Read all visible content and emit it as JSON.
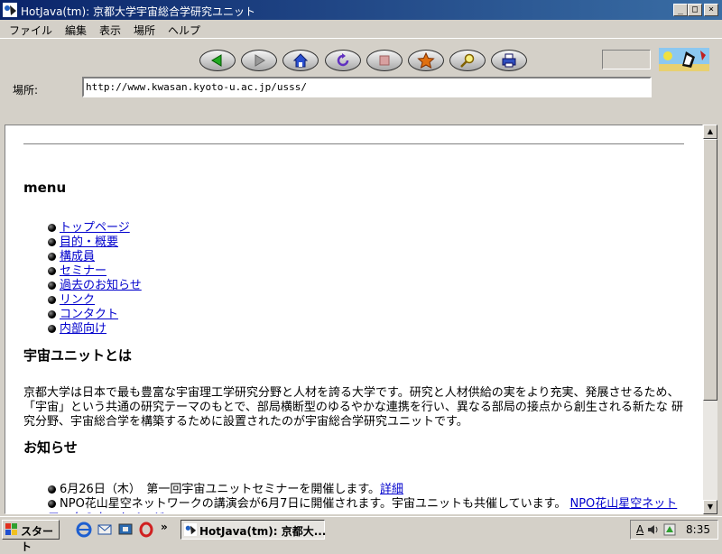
{
  "window": {
    "title": "HotJava(tm): 京都大学宇宙総合学研究ユニット",
    "minimize_glyph": "_",
    "maximize_glyph": "□",
    "close_glyph": "×"
  },
  "menu": [
    "ファイル",
    "編集",
    "表示",
    "場所",
    "ヘルプ"
  ],
  "toolbar": {
    "location_label": "場所:",
    "url": "http://www.kwasan.kyoto-u.ac.jp/usss/",
    "buttons": [
      "back-icon",
      "forward-icon",
      "home-icon",
      "reload-icon",
      "stop-icon",
      "bookmark-star-icon",
      "search-icon",
      "print-icon"
    ]
  },
  "page": {
    "menu_heading": "menu",
    "menu_links": [
      "トップページ",
      "目的・概要",
      "構成員",
      "セミナー",
      "過去のお知らせ",
      "リンク",
      "コンタクト",
      "内部向け"
    ],
    "about_heading": "宇宙ユニットとは",
    "about_text": "京都大学は日本で最も豊富な宇宙理工学研究分野と人材を誇る大学です。研究と人材供給の実をより充実、発展させるため、「宇宙」という共通の研究テーマのもとで、部局横断型のゆるやかな連携を行い、異なる部局の接点から創生される新たな 研究分野、宇宙総合学を構築するために設置されたのが宇宙総合学研究ユニットです。",
    "news_heading": "お知らせ",
    "news": [
      {
        "text": "6月26日（木）　第一回宇宙ユニットセミナーを開催します。",
        "link": "詳細"
      },
      {
        "text": "NPO花山星空ネットワークの講演会が6月7日に開催されます。宇宙ユニットも共催しています。 ",
        "link": "NPO花山星空ネットワークのホームページ"
      }
    ]
  },
  "taskbar": {
    "start_label": "スタート",
    "task_label": "HotJava(tm): 京都大...",
    "tray_ime": "A",
    "clock": "8:35",
    "chevron": "»"
  },
  "colors": {
    "titlebar": "#0a246a",
    "link": "#0000cc",
    "chrome": "#d4d0c8"
  }
}
